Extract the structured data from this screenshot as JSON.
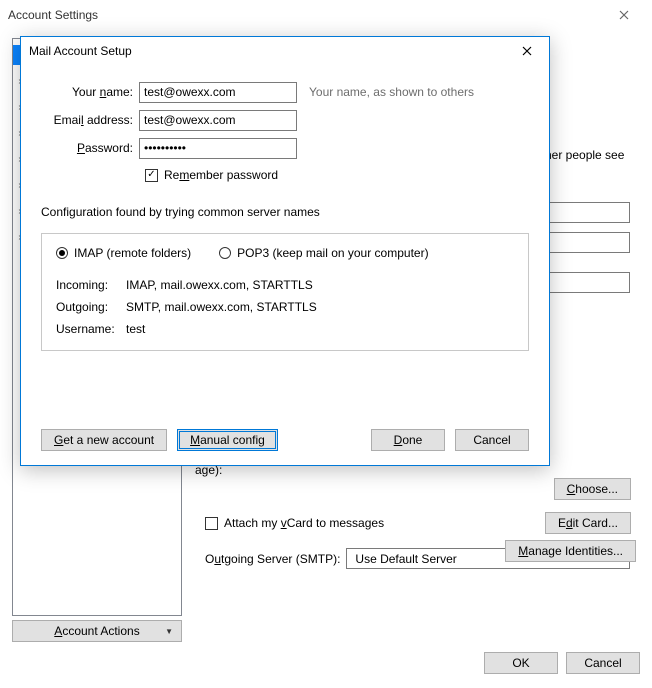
{
  "accountSettings": {
    "windowTitle": "Account Settings",
    "hintText": "her people see",
    "sigLabel": "age):",
    "chooseBtn": "Choose...",
    "editCardBtn": "Edit Card...",
    "vcardLabel": "Attach my vCard to messages",
    "smtpLabel": "Outgoing Server (SMTP):",
    "smtpValue": "Use Default Server",
    "manageBtn": "Manage Identities...",
    "accountActions": "Account Actions",
    "ok": "OK",
    "cancel": "Cancel"
  },
  "modal": {
    "title": "Mail Account Setup",
    "rows": {
      "nameLabel": "Your name:",
      "nameValue": "test@owexx.com",
      "nameHint": "Your name, as shown to others",
      "emailLabel": "Email address:",
      "emailValue": "test@owexx.com",
      "passLabel": "Password:",
      "passValue": "••••••••••",
      "remember": "Remember password"
    },
    "configMsg": "Configuration found by trying common server names",
    "proto": {
      "imap": "IMAP (remote folders)",
      "pop3": "POP3 (keep mail on your computer)",
      "incomingK": "Incoming:",
      "incomingV": "IMAP, mail.owexx.com, STARTTLS",
      "outgoingK": "Outgoing:",
      "outgoingV": "SMTP, mail.owexx.com, STARTTLS",
      "usernameK": "Username:",
      "usernameV": "test"
    },
    "buttons": {
      "getNew": "Get a new account",
      "manual": "Manual config",
      "done": "Done",
      "cancel": "Cancel"
    }
  }
}
